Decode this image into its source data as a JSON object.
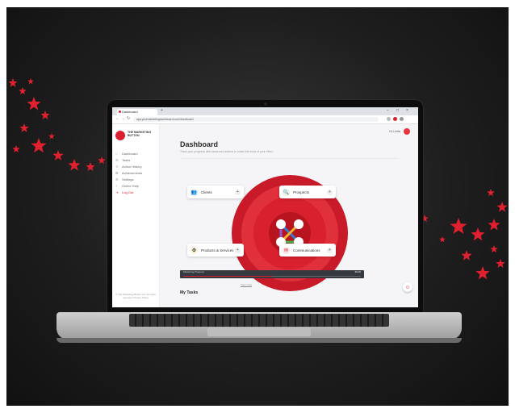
{
  "colors": {
    "brand": "#d8202f",
    "background": "#1e1e1e",
    "screen_bg": "#f5f5f7"
  },
  "browser": {
    "tab_title": "Dashboard",
    "url": "app.yourmarketingdashboard.com/dashboard",
    "controls": {
      "back": "←",
      "forward": "→",
      "reload": "↻",
      "minimize": "–",
      "maximize": "□",
      "close": "×",
      "new_tab": "+",
      "lock": "🔒"
    }
  },
  "sidebar": {
    "logo_text": "THE MARKETING BUTTON",
    "items": [
      {
        "icon": "⌂",
        "label": "Dashboard"
      },
      {
        "icon": "☰",
        "label": "Tasks"
      },
      {
        "icon": "⟲",
        "label": "Action History"
      },
      {
        "icon": "✪",
        "label": "Achievements"
      },
      {
        "icon": "⚙",
        "label": "Settings"
      },
      {
        "icon": "?",
        "label": "Online Help"
      },
      {
        "icon": "⇥",
        "label": "Log Out"
      }
    ],
    "footer": "© The Marketing Button Ltd. All rights reserved. Privacy Policy"
  },
  "header": {
    "greeting": "Hi, Linda"
  },
  "page": {
    "title": "Dashboard",
    "subtitle": "Track your progress with tasks and actions to make the most of your effort.",
    "cards": [
      {
        "label": "Clients",
        "icon": "👥",
        "plus": "+"
      },
      {
        "label": "Prospects",
        "icon": "🔍",
        "plus": "+"
      },
      {
        "label": "Products & Services",
        "icon": "⚙",
        "plus": "+"
      },
      {
        "label": "Communications",
        "icon": "✉",
        "plus": "+"
      }
    ],
    "progress": {
      "label": "Marketing Progress",
      "value_text": "46.00",
      "fraction": 0.5,
      "link": "View more"
    },
    "section_title": "My Tasks",
    "chat_icon": "☺"
  }
}
